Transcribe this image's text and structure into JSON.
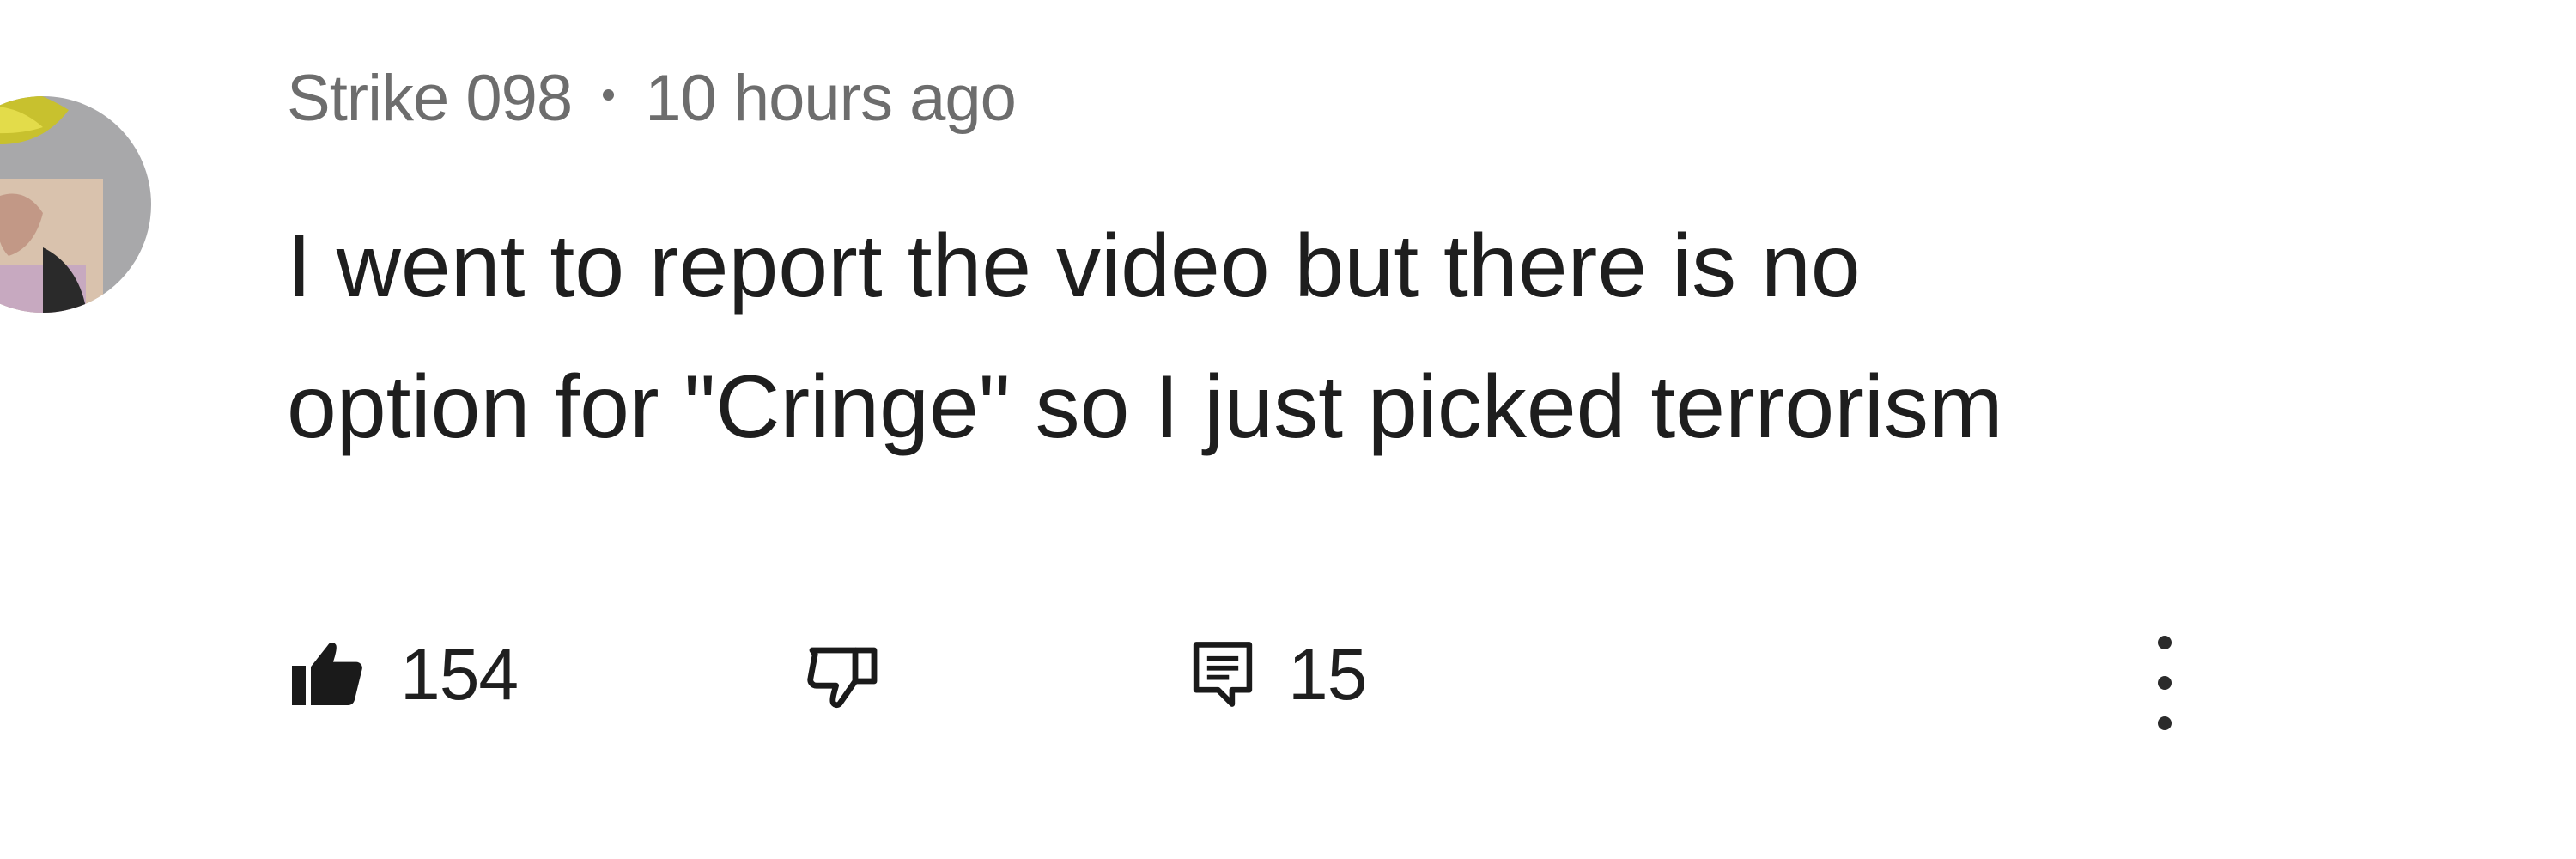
{
  "comment": {
    "author": "Strike 098",
    "timestamp": "10 hours ago",
    "text_lines": [
      "I went to report the video but there is no",
      "option for \"Cringe\" so I just picked terrorism"
    ],
    "like_count": "154",
    "reply_count": "15"
  },
  "icons": {
    "avatar": "avatar",
    "like": "thumbs-up-icon",
    "dislike": "thumbs-down-icon",
    "reply": "reply-icon",
    "more": "more-vertical-icon"
  }
}
